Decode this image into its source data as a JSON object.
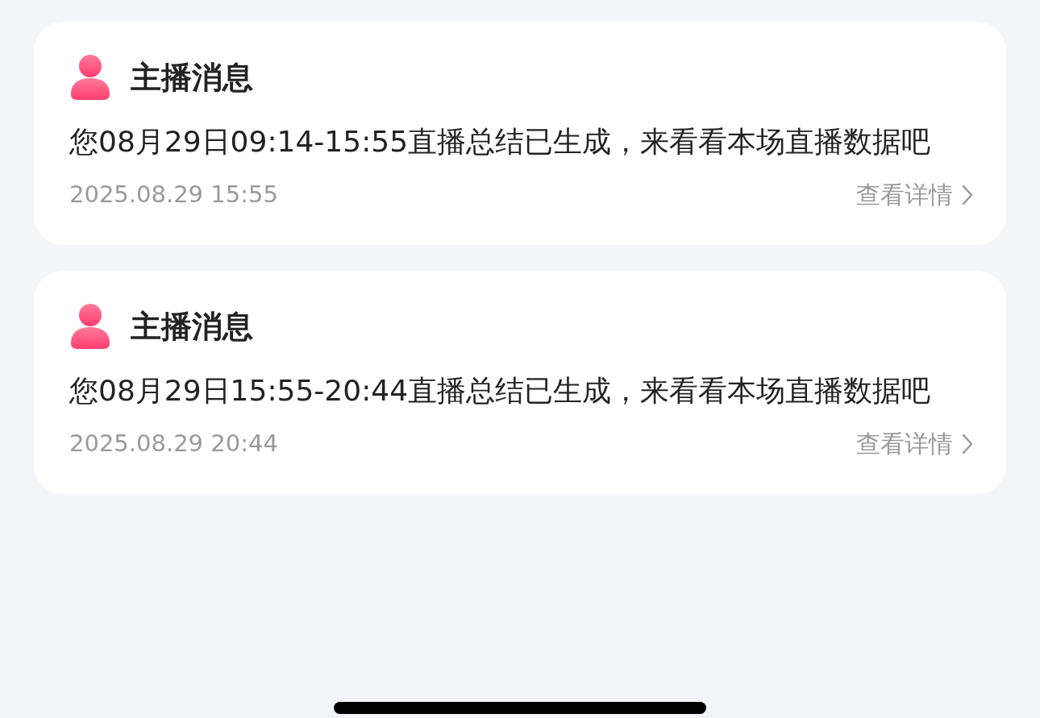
{
  "messages": [
    {
      "title": "主播消息",
      "body": "您08月29日09:14-15:55直播总结已生成，来看看本场直播数据吧",
      "time": "2025.08.29 15:55",
      "link": "查看详情"
    },
    {
      "title": "主播消息",
      "body": "您08月29日15:55-20:44直播总结已生成，来看看本场直播数据吧",
      "time": "2025.08.29 20:44",
      "link": "查看详情"
    }
  ]
}
